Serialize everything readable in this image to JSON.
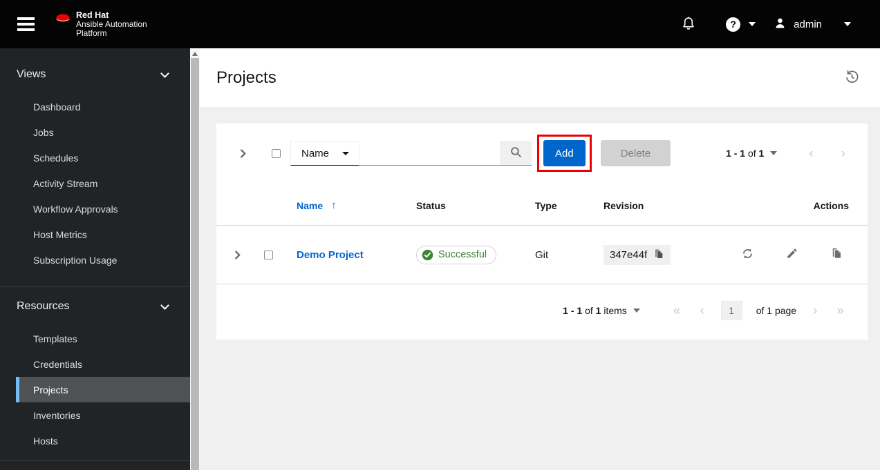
{
  "masthead": {
    "brand": {
      "bold": "Red Hat",
      "line2": "Ansible Automation",
      "line3": "Platform"
    },
    "help_glyph": "?",
    "user": "admin"
  },
  "sidebar": {
    "sections": [
      {
        "label": "Views",
        "items": [
          "Dashboard",
          "Jobs",
          "Schedules",
          "Activity Stream",
          "Workflow Approvals",
          "Host Metrics",
          "Subscription Usage"
        ]
      },
      {
        "label": "Resources",
        "items": [
          "Templates",
          "Credentials",
          "Projects",
          "Inventories",
          "Hosts"
        ],
        "active_item": "Projects"
      }
    ]
  },
  "page": {
    "title": "Projects"
  },
  "toolbar": {
    "filter_label": "Name",
    "add_label": "Add",
    "delete_label": "Delete",
    "pagination": {
      "range": "1 - 1",
      "of": " of ",
      "total": "1"
    }
  },
  "table": {
    "headers": [
      "Name",
      "Status",
      "Type",
      "Revision",
      "Actions"
    ],
    "rows": [
      {
        "name": "Demo Project",
        "status": "Successful",
        "type": "Git",
        "revision": "347e44f"
      }
    ]
  },
  "footer_pagination": {
    "range": "1 - 1",
    "of": " of ",
    "total": "1",
    "items_label": " items",
    "page_value": "1",
    "page_of_label": "of 1 page"
  },
  "icons": {
    "sort_asc": "↑",
    "angle_left": "‹",
    "angle_right": "›",
    "angle_double_left": "«",
    "angle_double_right": "»"
  },
  "colors": {
    "accent": "#0066cc",
    "success": "#3e8635",
    "annotation": "#ee0000",
    "active_indicator": "#73bcf7",
    "masthead_bg": "#040404",
    "sidebar_bg": "#212427"
  }
}
